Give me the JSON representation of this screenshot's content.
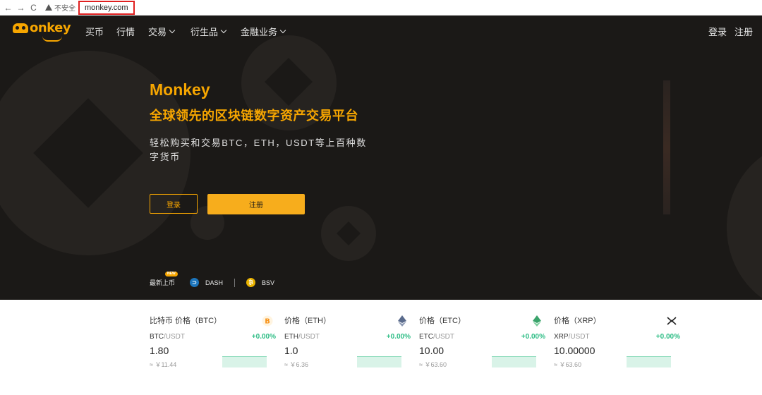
{
  "browser": {
    "back": "←",
    "forward": "→",
    "reload": "C",
    "security_label": "不安全",
    "url": "monkey.com"
  },
  "nav": {
    "logo_text": "onkey",
    "items": [
      {
        "label": "买币",
        "dropdown": false
      },
      {
        "label": "行情",
        "dropdown": false
      },
      {
        "label": "交易",
        "dropdown": true
      },
      {
        "label": "衍生品",
        "dropdown": true
      },
      {
        "label": "金融业务",
        "dropdown": true
      }
    ],
    "login": "登录",
    "register": "注册"
  },
  "hero": {
    "brand": "Monkey",
    "slogan": "全球领先的区块链数字资产交易平台",
    "description": "轻松购买和交易BTC，ETH，USDT等上百种数字货币",
    "login_button": "登录",
    "register_button": "注册",
    "accent_color": "#f7a600",
    "background_color": "#1b1917"
  },
  "new_listings": {
    "label": "最新上币",
    "badge": "NEW",
    "coins": [
      {
        "name": "DASH",
        "icon": "dash-icon",
        "color": "#1c75bc"
      },
      {
        "name": "BSV",
        "icon": "bsv-icon",
        "color": "#eab300"
      }
    ]
  },
  "tickers": [
    {
      "title": "比特币 价格（BTC）",
      "base": "BTC",
      "quote": "/USDT",
      "change": "+0.00%",
      "price": "1.80",
      "cny": "≈ ￥11.44",
      "icon": "btc-icon"
    },
    {
      "title": "价格（ETH）",
      "base": "ETH",
      "quote": "/USDT",
      "change": "+0.00%",
      "price": "1.0",
      "cny": "≈ ￥6.36",
      "icon": "eth-icon"
    },
    {
      "title": "价格（ETC）",
      "base": "ETC",
      "quote": "/USDT",
      "change": "+0.00%",
      "price": "10.00",
      "cny": "≈ ￥63.60",
      "icon": "etc-icon"
    },
    {
      "title": "价格（XRP）",
      "base": "XRP",
      "quote": "/USDT",
      "change": "+0.00%",
      "price": "10.00000",
      "cny": "≈ ￥63.60",
      "icon": "xrp-icon"
    }
  ],
  "colors": {
    "positive": "#2dbd85",
    "accent": "#f7a600"
  }
}
